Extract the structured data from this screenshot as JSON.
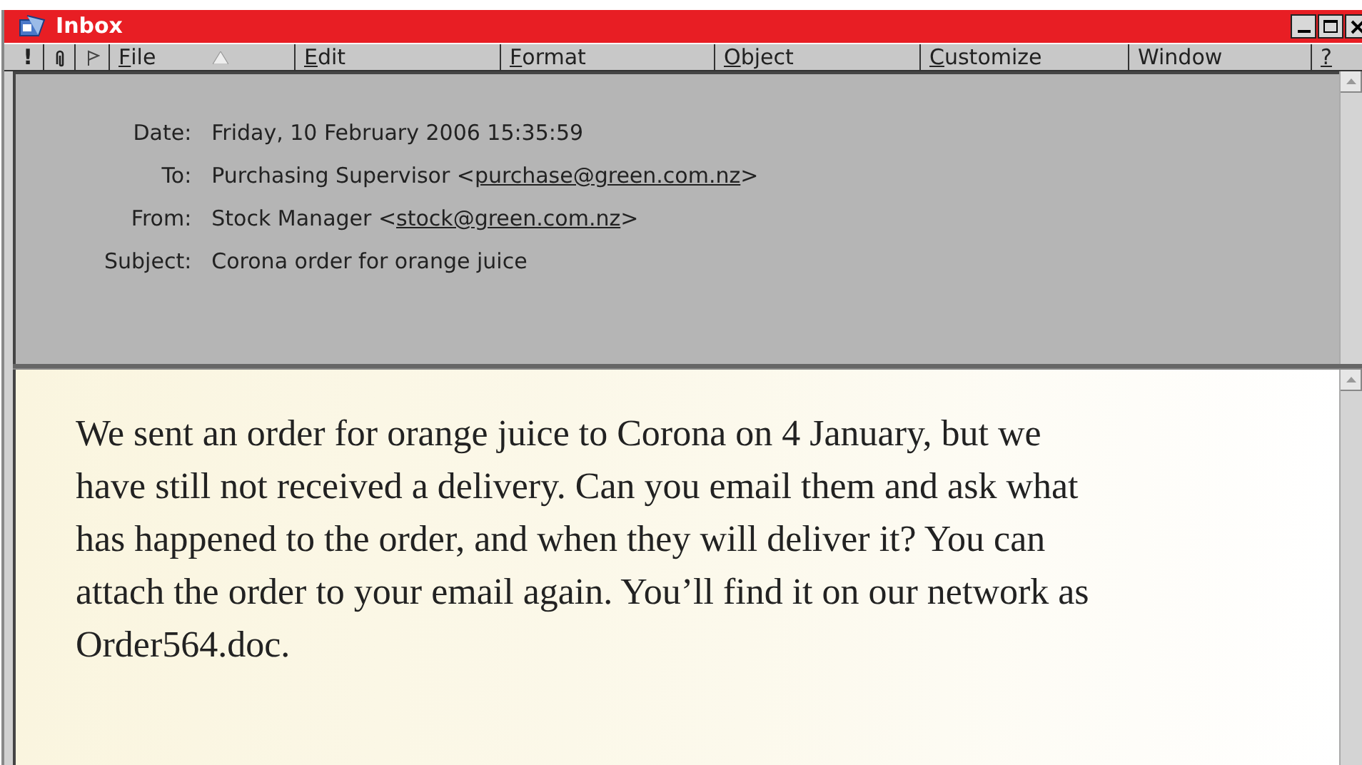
{
  "window": {
    "title": "Inbox"
  },
  "menu": [
    {
      "kind": "text",
      "label": "!",
      "mnemonic": false
    },
    {
      "kind": "attachment"
    },
    {
      "kind": "flag"
    },
    {
      "kind": "text",
      "label": "File",
      "mnemonic": true,
      "sort": true
    },
    {
      "kind": "text",
      "label": "Edit",
      "mnemonic": true
    },
    {
      "kind": "text",
      "label": "Format",
      "mnemonic": true
    },
    {
      "kind": "text",
      "label": "Object",
      "mnemonic": true
    },
    {
      "kind": "text",
      "label": "Customize",
      "mnemonic": true
    },
    {
      "kind": "text",
      "label": "Window",
      "mnemonic": false
    },
    {
      "kind": "text",
      "label": "?",
      "mnemonic": true
    }
  ],
  "header": [
    {
      "label": "Date:",
      "text": "Friday, 10 February 2006 15:35:59"
    },
    {
      "label": "To:",
      "text": "Purchasing Supervisor <",
      "link": "purchase@green.com.nz",
      "after": ">"
    },
    {
      "label": "From:",
      "text": "Stock Manager <",
      "link": "stock@green.com.nz",
      "after": ">"
    },
    {
      "label": "Subject:",
      "text": "Corona order for orange juice"
    }
  ],
  "body": "We sent an order for orange juice to Corona on 4 January, but we have still not received a delivery. Can you email them and ask what has happened to the order, and when they will deliver it? You can attach the order to your email again. You’ll find it on our network as Order564.doc."
}
